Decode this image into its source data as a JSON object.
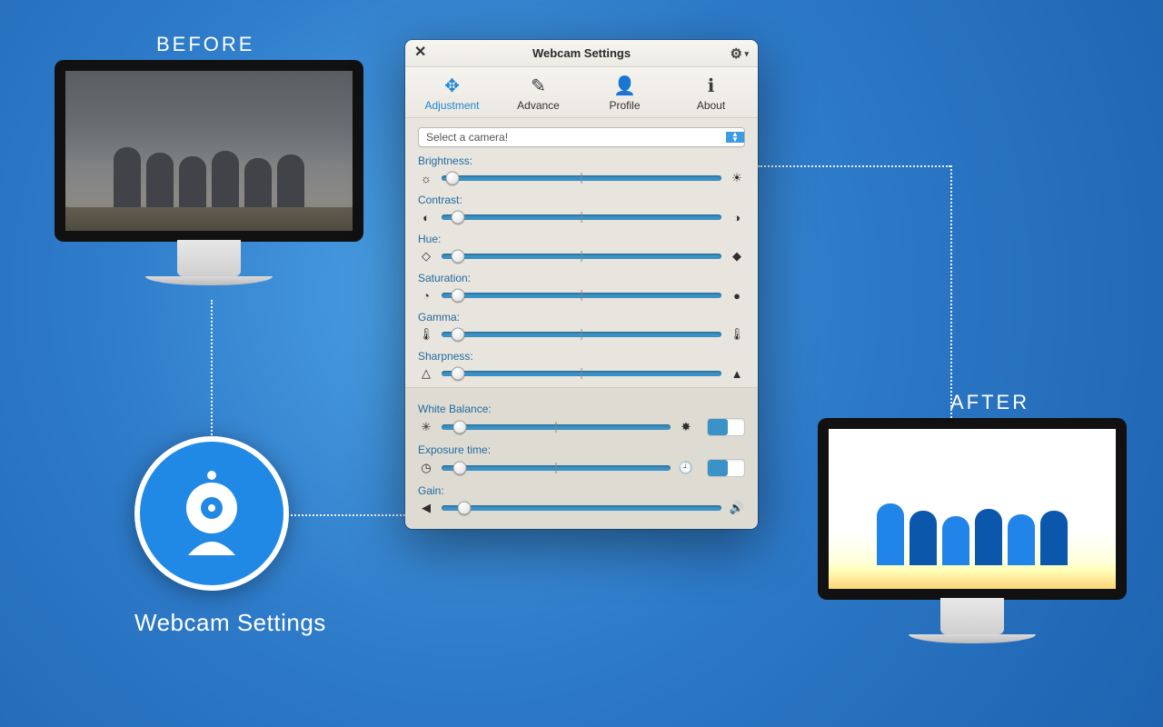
{
  "labels": {
    "before": "BEFORE",
    "after": "AFTER",
    "app_name": "Webcam Settings"
  },
  "window": {
    "title": "Webcam Settings",
    "tabs": {
      "adjustment": "Adjustment",
      "advance": "Advance",
      "profile": "Profile",
      "about": "About"
    },
    "camera_select": "Select a camera!",
    "sliders": {
      "brightness": {
        "label": "Brightness:",
        "value": 4,
        "icon_left": "brightness-low-icon",
        "icon_right": "brightness-high-icon",
        "glyph_l": "☼",
        "glyph_r": "☀"
      },
      "contrast": {
        "label": "Contrast:",
        "value": 6,
        "icon_left": "contrast-low-icon",
        "icon_right": "contrast-high-icon",
        "glyph_l": "◐",
        "glyph_r": "◑"
      },
      "hue": {
        "label": "Hue:",
        "value": 6,
        "icon_left": "hue-low-icon",
        "icon_right": "hue-high-icon",
        "glyph_l": "◇",
        "glyph_r": "◆"
      },
      "saturation": {
        "label": "Saturation:",
        "value": 6,
        "icon_left": "saturation-low-icon",
        "icon_right": "saturation-high-icon",
        "glyph_l": "◔",
        "glyph_r": "●"
      },
      "gamma": {
        "label": "Gamma:",
        "value": 6,
        "icon_left": "gamma-low-icon",
        "icon_right": "gamma-high-icon",
        "glyph_l": "🌡",
        "glyph_r": "🌡"
      },
      "sharpness": {
        "label": "Sharpness:",
        "value": 6,
        "icon_left": "sharpness-low-icon",
        "icon_right": "sharpness-high-icon",
        "glyph_l": "△",
        "glyph_r": "▲"
      },
      "white_balance": {
        "label": "White Balance:",
        "value": 8,
        "icon_left": "wb-low-icon",
        "icon_right": "wb-high-icon",
        "glyph_l": "✳",
        "glyph_r": "✸",
        "toggle": true
      },
      "exposure": {
        "label": "Exposure time:",
        "value": 8,
        "icon_left": "exposure-low-icon",
        "icon_right": "exposure-high-icon",
        "glyph_l": "◷",
        "glyph_r": "🕘",
        "toggle": true
      },
      "gain": {
        "label": "Gain:",
        "value": 8,
        "icon_left": "volume-low-icon",
        "icon_right": "volume-high-icon",
        "glyph_l": "◀",
        "glyph_r": "🔊"
      }
    }
  }
}
